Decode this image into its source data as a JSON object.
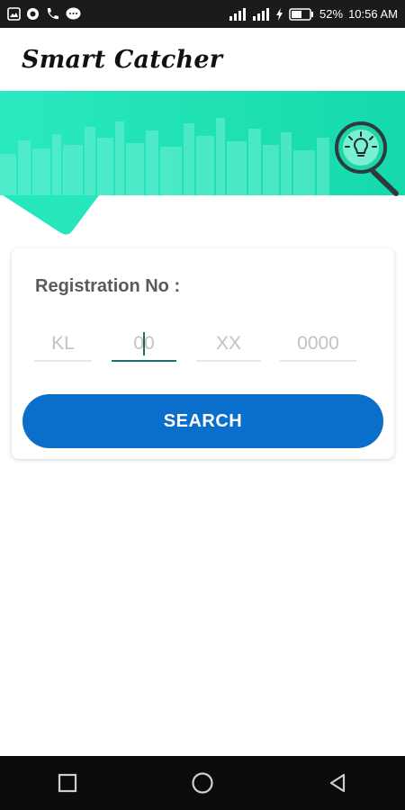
{
  "status_bar": {
    "battery": "52%",
    "time": "10:56 AM",
    "left_icons": [
      "gallery-icon",
      "circle-app-icon",
      "call-icon",
      "chat-icon"
    ],
    "right_icons": [
      "signal-icon",
      "signal-icon",
      "charging-icon",
      "battery-icon"
    ]
  },
  "app_bar": {
    "title": "Smart Catcher"
  },
  "banner": {
    "accent": "#29e9c1",
    "icon": "magnifier-bulb-icon"
  },
  "form": {
    "label": "Registration No :",
    "fields": [
      {
        "placeholder": "KL",
        "value": ""
      },
      {
        "placeholder": "00",
        "value": ""
      },
      {
        "placeholder": "XX",
        "value": ""
      },
      {
        "placeholder": "0000",
        "value": ""
      }
    ],
    "search_label": "SEARCH",
    "button_color": "#0a6fcb"
  },
  "nav_bar": {
    "icons": [
      "recent-apps-icon",
      "home-icon",
      "back-icon"
    ]
  }
}
